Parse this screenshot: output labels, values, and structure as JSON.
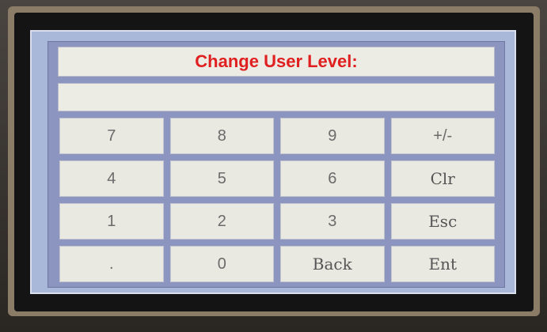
{
  "dialog": {
    "title": "Change User Level:",
    "entry_value": ""
  },
  "keypad": {
    "rows": [
      [
        "7",
        "8",
        "9",
        "+/-"
      ],
      [
        "4",
        "5",
        "6",
        "Clr"
      ],
      [
        "1",
        "2",
        "3",
        "Esc"
      ],
      [
        ".",
        "0",
        "Back",
        "Ent"
      ]
    ]
  },
  "colors": {
    "title": "#e02020",
    "panel": "#8b95c0",
    "key_face": "#e9e8e1"
  }
}
